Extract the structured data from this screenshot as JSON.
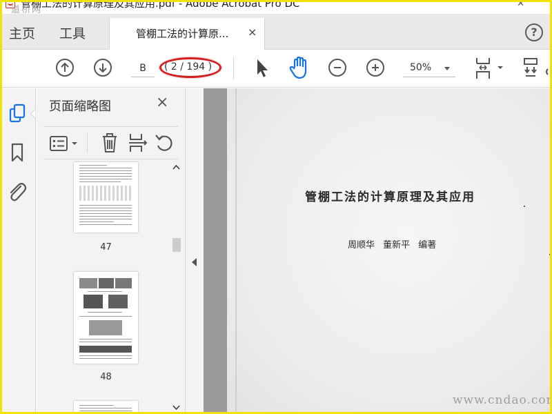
{
  "window": {
    "title": "管棚工法的计算原理及其应用.pdf - Adobe Acrobat Pro DC",
    "logo_watermark": "道桥网"
  },
  "tabs": {
    "home_label": "主页",
    "tools_label": "工具",
    "document_tab_label": "管棚工法的计算原...",
    "document_tab_close": "×",
    "help": "?"
  },
  "toolbar": {
    "page_field_value": "B",
    "page_count": "( 2 / 194 )",
    "zoom_value": "50%",
    "highlight_color": "#d41f1f",
    "icons": [
      "prev-page-icon",
      "next-page-icon",
      "select-arrow-icon",
      "hand-tool-icon",
      "zoom-out-icon",
      "zoom-in-icon",
      "fit-page-icon",
      "scroll-mode-icon"
    ]
  },
  "rail": {
    "icons": [
      "page-thumbnails-icon",
      "bookmark-icon",
      "attachment-icon"
    ],
    "active_color": "#1473e6"
  },
  "panel": {
    "title": "页面缩略图",
    "close": "×",
    "thumbnails": [
      {
        "label": "47"
      },
      {
        "label": "48"
      }
    ]
  },
  "document": {
    "title": "管棚工法的计算原理及其应用",
    "authors": "周顺华  董新平  编著"
  },
  "watermark": {
    "site": "www.cndao.com"
  }
}
